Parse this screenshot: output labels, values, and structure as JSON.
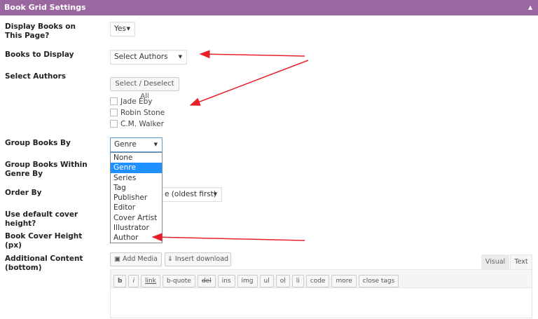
{
  "header": {
    "title": "Book Grid Settings",
    "toggle": "▲"
  },
  "fields": {
    "display_books": {
      "label": "Display Books on This Page?",
      "value": "Yes"
    },
    "books_to_display": {
      "label": "Books to Display",
      "value": "Select Authors"
    },
    "select_authors": {
      "label": "Select Authors",
      "button": "Select / Deselect All",
      "authors": [
        "Jade Eby",
        "Robin Stone",
        "C.M. Walker"
      ]
    },
    "group_by": {
      "label": "Group Books By",
      "value": "Genre",
      "options": [
        "None",
        "Genre",
        "Series",
        "Tag",
        "Publisher",
        "Editor",
        "Cover Artist",
        "Illustrator",
        "Author"
      ]
    },
    "group_within": {
      "label": "Group Books Within Genre By"
    },
    "order_by": {
      "label": "Order By",
      "value_visible": "e (oldest first)"
    },
    "default_cover": {
      "label": "Use default cover height?"
    },
    "cover_height": {
      "label": "Book Cover Height (px)"
    },
    "additional": {
      "label": "Additional Content (bottom)",
      "add_media": "Add Media",
      "insert_download": "Insert download",
      "tab_visual": "Visual",
      "tab_text": "Text",
      "toolbar": [
        "b",
        "i",
        "link",
        "b-quote",
        "del",
        "ins",
        "img",
        "ul",
        "ol",
        "li",
        "code",
        "more",
        "close tags"
      ]
    }
  },
  "annotation_color": "#e8202a"
}
